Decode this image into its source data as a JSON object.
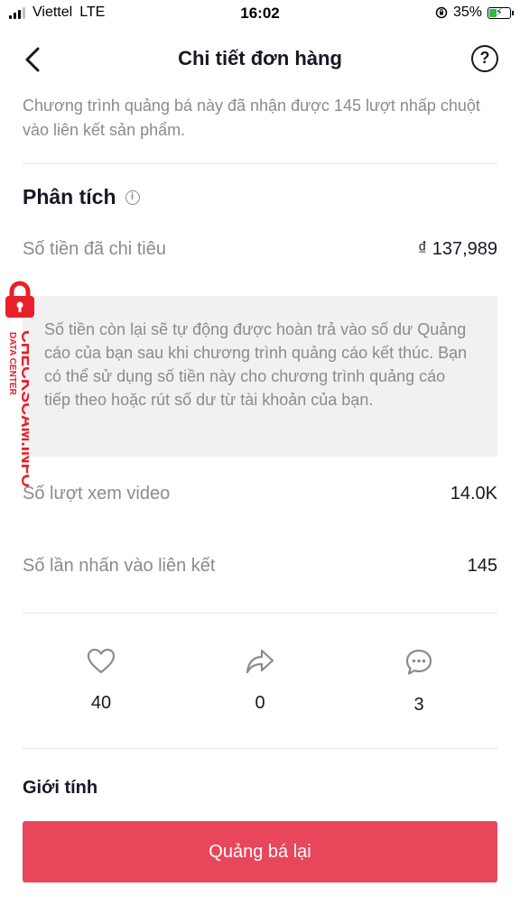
{
  "status_bar": {
    "carrier": "Viettel",
    "network": "LTE",
    "time": "16:02",
    "battery_percent": "35%",
    "battery_level": 0.35,
    "battery_color": "#2fb84a"
  },
  "header": {
    "back_icon": "chevron-left-icon",
    "title": "Chi tiết đơn hàng",
    "help_icon": "question-circle-icon",
    "help_glyph": "?"
  },
  "intro_text": "Chương trình quảng bá này đã nhận được 145 lượt nhấp chuột vào liên kết sản phẩm.",
  "analysis": {
    "title": "Phân tích",
    "info_glyph": "i",
    "spent_label": "Số tiền đã chi tiêu",
    "spent_value": "₫ 137,989",
    "note": "Số tiền còn lại sẽ tự động được hoàn trả vào số dư Quảng cáo của bạn sau khi chương trình quảng cáo kết thúc. Bạn có thể sử dụng số tiền này cho chương trình quảng cáo tiếp theo hoặc rút số dư từ tài khoản của bạn.",
    "views_label": "Số lượt xem video",
    "views_value": "14.0K",
    "clicks_label": "Số lần nhấn vào liên kết",
    "clicks_value": "145"
  },
  "engagement": {
    "likes": "40",
    "shares": "0",
    "comments": "3"
  },
  "gender_title": "Giới tính",
  "cta_label": "Quảng bá lại",
  "watermark": {
    "text": "CHECKSCAM.INFO",
    "subtext": "DATA CENTER",
    "color": "#e8202a"
  },
  "colors": {
    "accent": "#e8465b",
    "secondary_text": "#8a8b91",
    "note_background": "#f1f1f2"
  }
}
